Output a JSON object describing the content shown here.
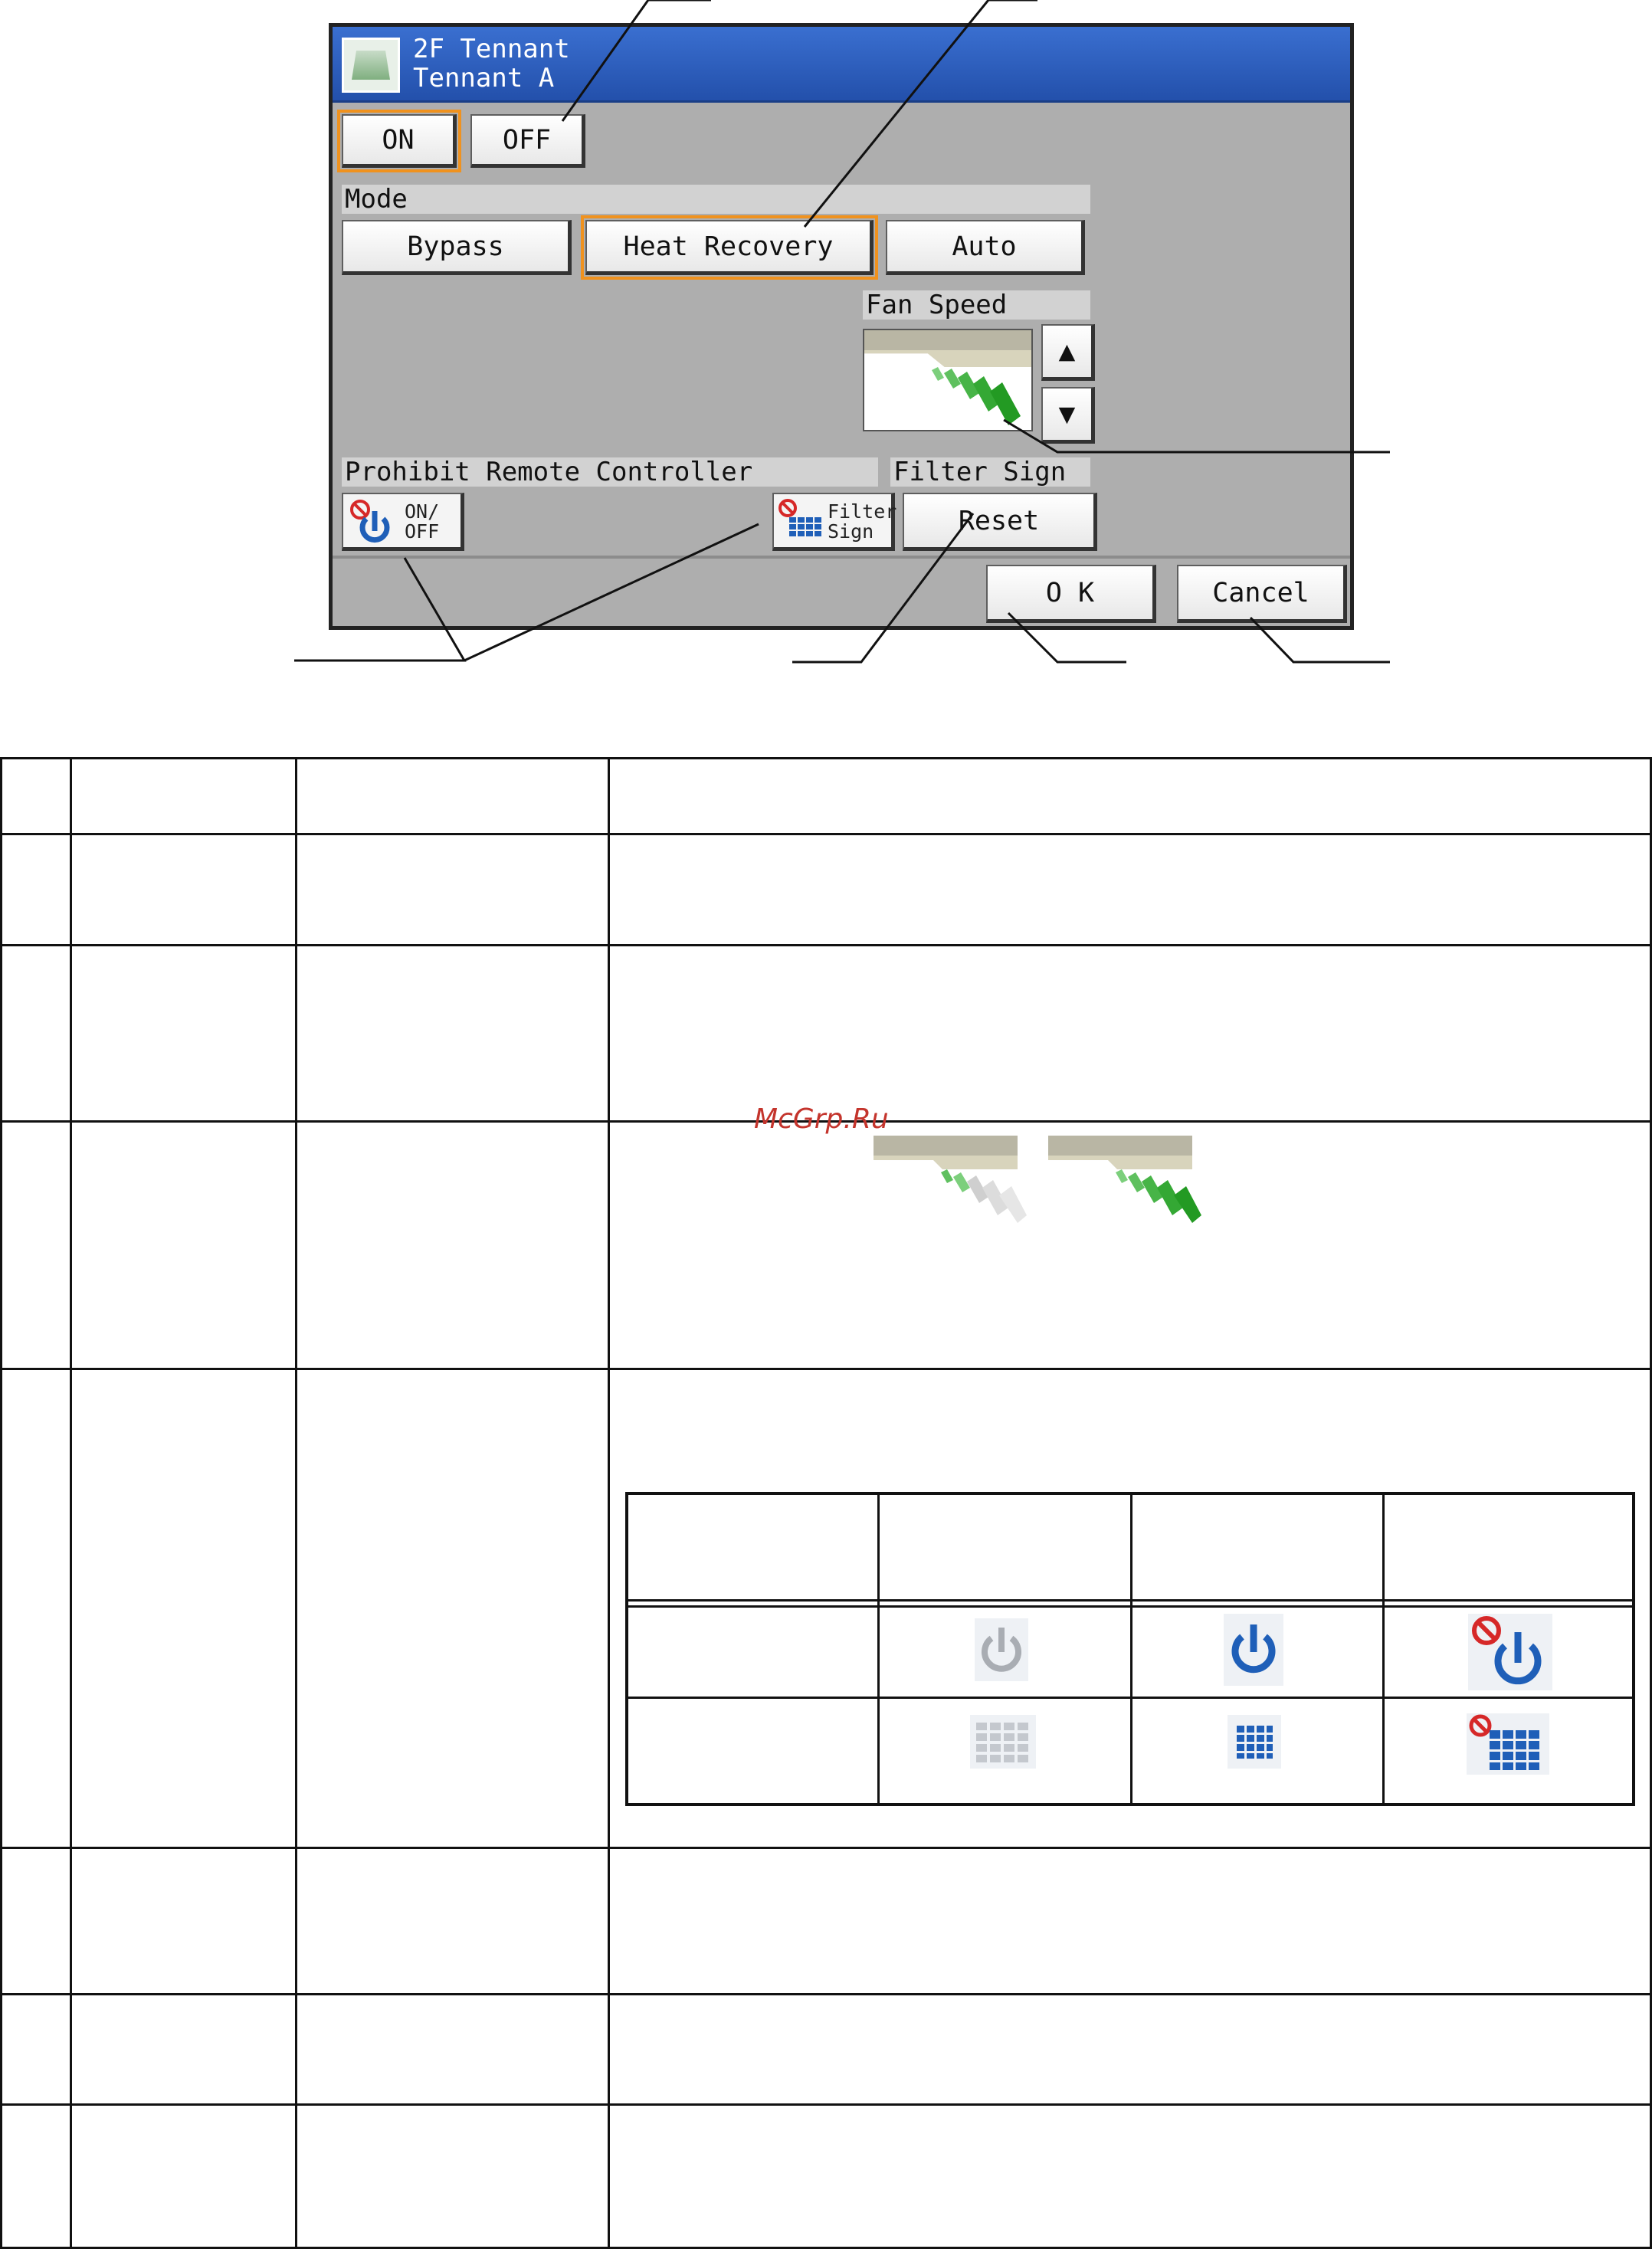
{
  "screen": {
    "title": {
      "line1": "2F Tennant",
      "line2": "Tennant A"
    },
    "power": {
      "on_label": "ON",
      "off_label": "OFF",
      "selected": "ON"
    },
    "mode": {
      "header": "Mode",
      "options": [
        "Bypass",
        "Heat Recovery",
        "Auto"
      ],
      "selected": "Heat Recovery"
    },
    "fan_speed": {
      "header": "Fan Speed",
      "up_label": "▲",
      "down_label": "▼"
    },
    "prohibit": {
      "header": "Prohibit Remote Controller",
      "onoff_label": "ON/\nOFF",
      "filter_label": "Filter\nSign"
    },
    "filter_sign": {
      "header": "Filter Sign",
      "reset_label": "Reset"
    },
    "footer": {
      "ok_label": "O K",
      "cancel_label": "Cancel"
    }
  },
  "watermark": "McGrp.Ru",
  "colors": {
    "title_blue": "#2c5cc0",
    "selected_outline": "#f0921e",
    "screen_bg": "#aeaeae",
    "icon_blue": "#1f5fb8",
    "prohibit_red": "#d62828",
    "fan_green": "#3cb043"
  }
}
